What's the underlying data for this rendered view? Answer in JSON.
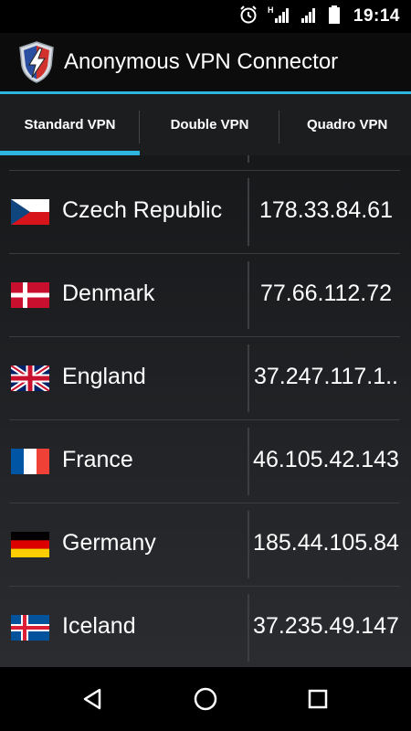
{
  "status_bar": {
    "time": "19:14",
    "icons": [
      "alarm-icon",
      "signal-h-icon",
      "signal-icon",
      "battery-icon"
    ]
  },
  "app": {
    "title": "Anonymous VPN Connector",
    "icon": "shield-lightning-icon",
    "accent_color": "#2eb5df"
  },
  "tabs": [
    {
      "label": "Standard VPN",
      "selected": true
    },
    {
      "label": "Double VPN",
      "selected": false
    },
    {
      "label": "Quadro VPN",
      "selected": false
    }
  ],
  "servers": [
    {
      "country": "Czech Republic",
      "ip": "178.33.84.61",
      "flag": "czech-flag-icon"
    },
    {
      "country": "Denmark",
      "ip": "77.66.112.72",
      "flag": "denmark-flag-icon"
    },
    {
      "country": "England",
      "ip": "37.247.117.1..",
      "flag": "uk-flag-icon"
    },
    {
      "country": "France",
      "ip": "46.105.42.143",
      "flag": "france-flag-icon"
    },
    {
      "country": "Germany",
      "ip": "185.44.105.84",
      "flag": "germany-flag-icon"
    },
    {
      "country": "Iceland",
      "ip": "37.235.49.147",
      "flag": "iceland-flag-icon"
    }
  ],
  "nav_bar": [
    "back-icon",
    "home-icon",
    "recents-icon"
  ]
}
